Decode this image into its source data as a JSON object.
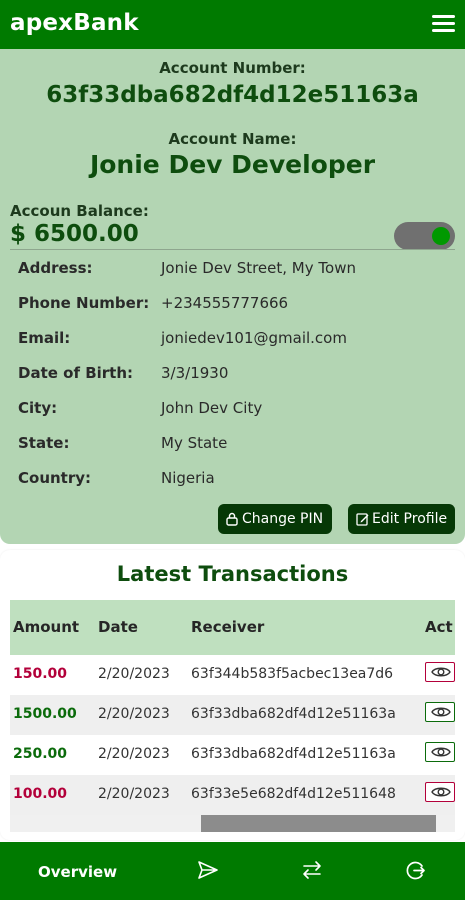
{
  "header": {
    "brand": "apexBank",
    "menu_icon": "hamburger-menu-icon"
  },
  "account": {
    "number_label": "Account Number:",
    "number": "63f33dba682df4d12e51163a",
    "name_label": "Account Name:",
    "name": "Jonie Dev Developer",
    "balance_label": "Accoun Balance:",
    "balance": "$ 6500.00",
    "balance_visible": true
  },
  "details": [
    {
      "label": "Address:",
      "value": "Jonie Dev Street, My Town"
    },
    {
      "label": "Phone Number:",
      "value": "+234555777666"
    },
    {
      "label": "Email:",
      "value": "joniedev101@gmail.com"
    },
    {
      "label": "Date of Birth:",
      "value": "3/3/1930"
    },
    {
      "label": "City:",
      "value": "John Dev City"
    },
    {
      "label": "State:",
      "value": "My State"
    },
    {
      "label": "Country:",
      "value": "Nigeria"
    }
  ],
  "actions": {
    "change_pin": "Change PIN",
    "change_pin_icon": "lock-icon",
    "edit_profile": "Edit Profile",
    "edit_profile_icon": "edit-icon"
  },
  "transactions": {
    "title": "Latest Transactions",
    "columns": [
      "Amount",
      "Date",
      "Receiver",
      "Act"
    ],
    "rows": [
      {
        "amount": "150.00",
        "date": "2/20/2023",
        "receiver": "63f344b583f5acbec13ea7d6",
        "status_color": "#b3003a"
      },
      {
        "amount": "1500.00",
        "date": "2/20/2023",
        "receiver": "63f33dba682df4d12e51163a",
        "status_color": "#0b6b0b"
      },
      {
        "amount": "250.00",
        "date": "2/20/2023",
        "receiver": "63f33dba682df4d12e51163a",
        "status_color": "#0b6b0b"
      },
      {
        "amount": "100.00",
        "date": "2/20/2023",
        "receiver": "63f33e5e682df4d12e511648",
        "status_color": "#b3003a"
      }
    ]
  },
  "bottom_nav": {
    "overview": "Overview",
    "icons": [
      "send-icon",
      "transfer-icon",
      "logout-icon"
    ]
  },
  "colors": {
    "brand_green": "#007a00",
    "card_green": "#b3d5b3",
    "button_dark": "#063806",
    "debit_red": "#b3003a",
    "credit_green": "#0b6b0b"
  }
}
